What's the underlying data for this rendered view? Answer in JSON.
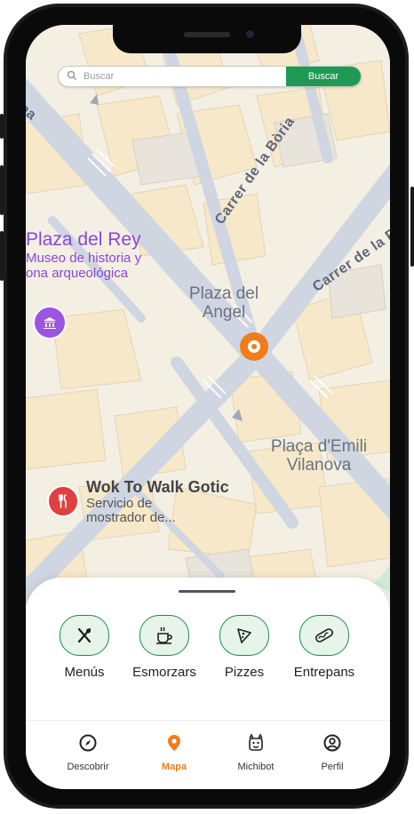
{
  "search": {
    "placeholder": "Buscar",
    "button_label": "Buscar"
  },
  "map": {
    "places": [
      {
        "name": "Plaza del Rey",
        "desc_line1": "Museo de historia y",
        "desc_line2": "ona arqueológica"
      },
      {
        "name": "Wok To Walk Gotic",
        "desc_line1": "Servicio de",
        "desc_line2": "mostrador de..."
      }
    ],
    "squares": [
      {
        "line1": "Plaza del",
        "line2": "Angel"
      },
      {
        "line1": "Plaça d'Emili",
        "line2": "Vilanova"
      }
    ],
    "streets": [
      "Carrer de la Bòria",
      "Carrer de la Pri",
      "na"
    ]
  },
  "categories": [
    {
      "label": "Menús",
      "icon": "utensils-icon"
    },
    {
      "label": "Esmorzars",
      "icon": "coffee-cup-icon"
    },
    {
      "label": "Pizzes",
      "icon": "pizza-slice-icon"
    },
    {
      "label": "Entrepans",
      "icon": "sandwich-icon"
    }
  ],
  "tabs": [
    {
      "label": "Descobrir",
      "icon": "compass-icon",
      "active": false
    },
    {
      "label": "Mapa",
      "icon": "map-pin-icon",
      "active": true
    },
    {
      "label": "Michibot",
      "icon": "cat-bot-icon",
      "active": false
    },
    {
      "label": "Perfil",
      "icon": "user-circle-icon",
      "active": false
    }
  ],
  "colors": {
    "accent_green": "#1f9a55",
    "active_tab_orange": "#ef7d1a",
    "poi_purple": "#8a45d9",
    "poi_red": "#e04040"
  }
}
